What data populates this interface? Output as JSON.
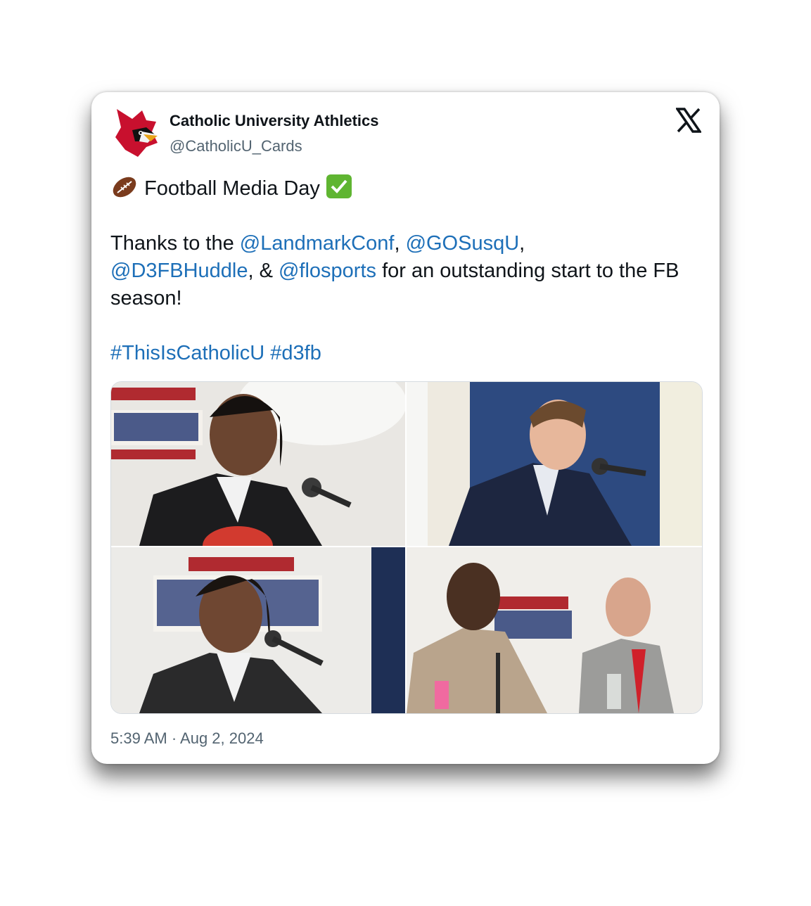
{
  "account": {
    "name": "Catholic University Athletics",
    "handle": "@CatholicU_Cards",
    "avatar_icon": "cardinal-logo"
  },
  "platform_icon": "x-logo-icon",
  "tweet": {
    "line1": {
      "emoji_left": "football",
      "text": "Football Media Day",
      "emoji_right": "check-mark-button"
    },
    "para2": {
      "t1": "Thanks to the ",
      "m1": "@LandmarkConf",
      "t2": ", ",
      "m2": "@GOSusqU",
      "t3": ",",
      "m3": "@D3FBHuddle",
      "t4": ", & ",
      "m4": "@flosports",
      "t5": " for an outstanding start to the FB season!"
    },
    "hashtags": {
      "h1": "#ThisIsCatholicU",
      "h2": "#d3fb"
    }
  },
  "media": {
    "photos": [
      {
        "alt": "Player in dark blazer at microphone in front of Landmark Conference banner"
      },
      {
        "alt": "Young man in navy suit at microphone"
      },
      {
        "alt": "Player with locs speaking into microphone"
      },
      {
        "alt": "Two coaches seated at table with microphones"
      }
    ]
  },
  "timestamp": "5:39 AM · Aug 2, 2024",
  "colors": {
    "link": "#1d6fb8",
    "name": "#0f1419",
    "secondary": "#536471",
    "cardinal_red": "#c8102e"
  }
}
